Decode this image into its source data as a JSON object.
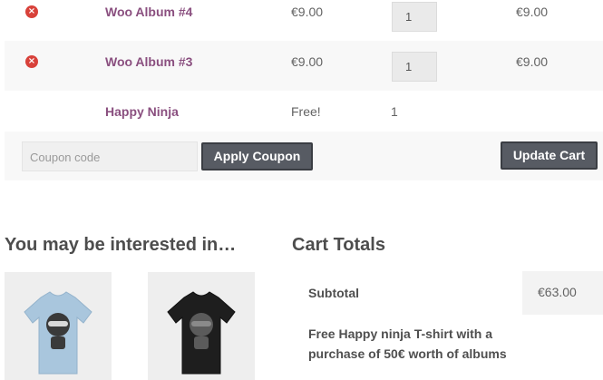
{
  "cart": {
    "rows": [
      {
        "name": "Woo Album #4",
        "price": "€9.00",
        "quantity": "1",
        "subtotal": "€9.00"
      },
      {
        "name": "Woo Album #3",
        "price": "€9.00",
        "quantity": "1",
        "subtotal": "€9.00"
      },
      {
        "name": "Happy Ninja",
        "price": "Free!",
        "quantity": "1"
      }
    ],
    "remove_icon": "×",
    "coupon_placeholder": "Coupon code",
    "apply_coupon_label": "Apply Coupon",
    "update_cart_label": "Update Cart"
  },
  "cross_sells": {
    "title": "You may be interested in…",
    "products": [
      {
        "icon": "tshirt-light-blue-ninja",
        "color": "#a9c6dd"
      },
      {
        "icon": "tshirt-black-ninja",
        "color": "#1e1e1e"
      }
    ]
  },
  "cart_totals": {
    "title": "Cart Totals",
    "subtotal_label": "Subtotal",
    "subtotal_value": "€63.00",
    "promo_line1": "Free Happy ninja T-shirt with a",
    "promo_line2": "purchase of 50€ worth of albums"
  },
  "colors": {
    "link": "#8a4f7f",
    "button": "#575b63",
    "remove": "#d8413a"
  }
}
